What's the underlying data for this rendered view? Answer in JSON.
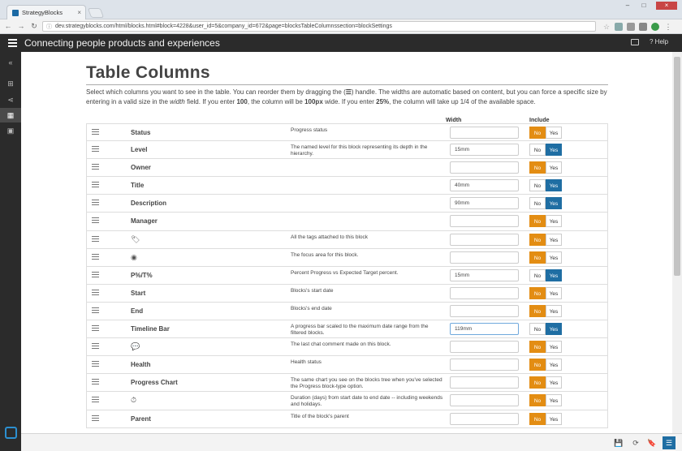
{
  "browser": {
    "tab_title": "StrategyBlocks",
    "tab_close": "×",
    "url": "dev.strategyblocks.com/html/blocks.html#block=4228&user_id=5&company_id=672&page=blocksTableColumnssection=blockSettings",
    "url_info": "ⓘ",
    "back": "←",
    "forward": "→",
    "reload": "↻",
    "minimize": "–",
    "maximize": "□",
    "close": "×"
  },
  "app": {
    "title": "Connecting people products and experiences",
    "help_label": "Help"
  },
  "sidebar": {
    "collapse": "«",
    "items": [
      {
        "name": "hierarchy-icon",
        "glyph": "⊞"
      },
      {
        "name": "share-icon",
        "glyph": "⋖"
      },
      {
        "name": "table-icon",
        "glyph": "▦"
      },
      {
        "name": "calendar-icon",
        "glyph": "▣"
      }
    ]
  },
  "page": {
    "title": "Table Columns",
    "intro": {
      "p1": "Select which columns you want to see in the table. You can reorder them by dragging the (",
      "handle_glyph": "☰",
      "p2": ") handle. The widths are automatic based on content, but you can force a specific size by entering in a valid size in the ",
      "width_word": "width",
      "p3": " field. If you enter ",
      "v100": "100",
      "p4": ", the column will be ",
      "v100px": "100px",
      "p5": " wide. If you enter ",
      "v25": "25%",
      "p6": ", the column will take up 1/4 of the available space."
    },
    "headers": {
      "width": "Width",
      "include": "Include"
    },
    "toggle": {
      "no": "No",
      "yes": "Yes"
    },
    "rows": [
      {
        "name": "Status",
        "desc": "Progress status",
        "width": "",
        "include": "no"
      },
      {
        "name": "Level",
        "desc": "The named level for this block representing its depth in the hierarchy.",
        "width": "15mm",
        "include": "yes"
      },
      {
        "name": "Owner",
        "desc": "",
        "width": "",
        "include": "no"
      },
      {
        "name": "Title",
        "desc": "",
        "width": "40mm",
        "include": "yes"
      },
      {
        "name": "Description",
        "desc": "",
        "width": "90mm",
        "include": "yes"
      },
      {
        "name": "Manager",
        "desc": "",
        "width": "",
        "include": "no"
      },
      {
        "name": "",
        "icon": "tags-icon",
        "glyph": "🏷",
        "desc": "All the tags attached to this block",
        "width": "",
        "include": "no"
      },
      {
        "name": "",
        "icon": "focus-area-icon",
        "glyph": "◉",
        "desc": "The focus area for this block.",
        "width": "",
        "include": "no"
      },
      {
        "name": "P%/T%",
        "desc": "Percent Progress vs Expected Target percent.",
        "width": "15mm",
        "include": "yes"
      },
      {
        "name": "Start",
        "desc": "Blocks's start date",
        "width": "",
        "include": "no"
      },
      {
        "name": "End",
        "desc": "Blocks's end date",
        "width": "",
        "include": "no"
      },
      {
        "name": "Timeline Bar",
        "desc": "A progress bar scaled to the maximum date range from the filtered blocks.",
        "width": "119mm",
        "include": "yes",
        "focused": true
      },
      {
        "name": "",
        "icon": "comment-icon",
        "glyph": "💬",
        "desc": "The last chat comment made on this block.",
        "width": "",
        "include": "no"
      },
      {
        "name": "Health",
        "desc": "Health status",
        "width": "",
        "include": "no"
      },
      {
        "name": "Progress Chart",
        "desc": "The same chart you see on the blocks tree when you've selected the Progress block-type option.",
        "width": "",
        "include": "no"
      },
      {
        "name": "",
        "icon": "clock-icon",
        "glyph": "⏱",
        "desc": "Duration (days) from start date to end date -- including weekends and holidays.",
        "width": "",
        "include": "no"
      },
      {
        "name": "Parent",
        "desc": "Title of the block's parent",
        "width": "",
        "include": "no"
      }
    ]
  },
  "bottombar": {
    "save": "💾",
    "refresh": "⟳",
    "bookmark": "🔖",
    "settings": "☰"
  },
  "colors": {
    "no_active": "#e38d13",
    "yes_active": "#1f6ea3",
    "header_bg": "#2b2b2b"
  }
}
